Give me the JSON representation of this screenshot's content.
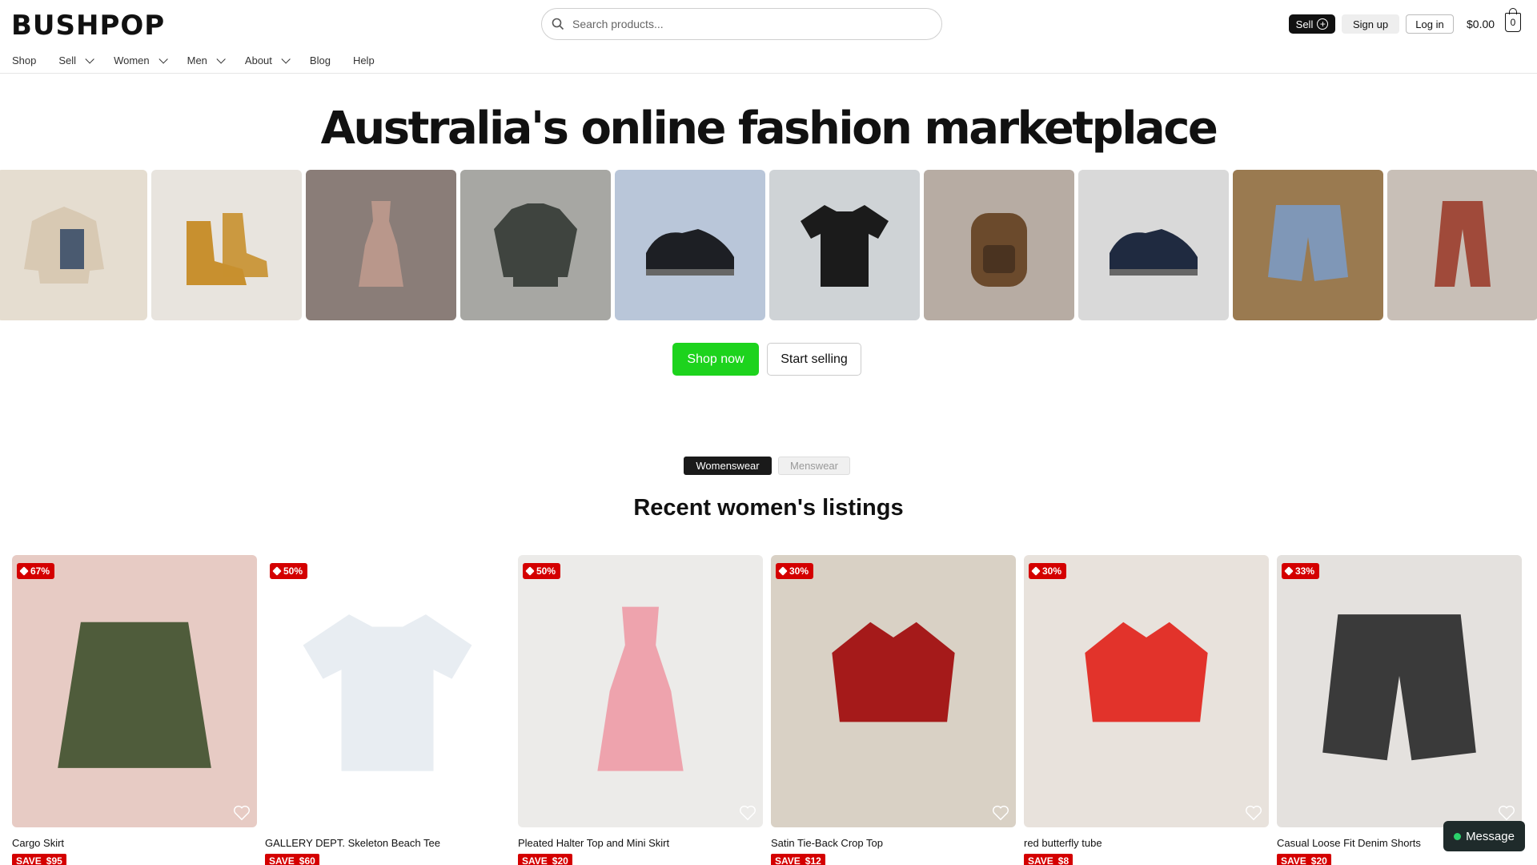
{
  "brand": {
    "logo": "BUSHPOP"
  },
  "search": {
    "placeholder": "Search products..."
  },
  "header": {
    "sell_label": "Sell",
    "signup_label": "Sign up",
    "login_label": "Log in",
    "cart_total": "$0.00",
    "cart_count": "0"
  },
  "nav": {
    "shop": "Shop",
    "sell": "Sell",
    "women": "Women",
    "men": "Men",
    "about": "About",
    "blog": "Blog",
    "help": "Help"
  },
  "hero": {
    "title": "Australia's online fashion marketplace",
    "shop_now": "Shop now",
    "start_selling": "Start selling",
    "tiles": [
      {
        "icon": "fleece-jacket-icon",
        "bg": "#e5ddd0",
        "fg": "#d8c9b3"
      },
      {
        "icon": "boots-icon",
        "bg": "#e8e4de",
        "fg": "#c8902f"
      },
      {
        "icon": "dress-icon",
        "bg": "#8a7d78",
        "fg": "#b9978b"
      },
      {
        "icon": "jacket-icon",
        "bg": "#a7a7a3",
        "fg": "#3f443f"
      },
      {
        "icon": "sneaker-icon",
        "bg": "#b9c6d9",
        "fg": "#1d1f24"
      },
      {
        "icon": "tshirt-icon",
        "bg": "#cfd3d6",
        "fg": "#1b1b1b"
      },
      {
        "icon": "backpack-icon",
        "bg": "#b7aca3",
        "fg": "#6b4a2c"
      },
      {
        "icon": "sneaker-icon",
        "bg": "#d9d9d9",
        "fg": "#1f2a40"
      },
      {
        "icon": "shorts-icon",
        "bg": "#9a7a50",
        "fg": "#7f97b7"
      },
      {
        "icon": "pants-icon",
        "bg": "#c8bfb7",
        "fg": "#a04a3a"
      }
    ]
  },
  "toggle": {
    "womens": "Womenswear",
    "mens": "Menswear"
  },
  "listings": {
    "title": "Recent women's listings",
    "items": [
      {
        "name": "Cargo Skirt",
        "discount": "67%",
        "save": "SAVE",
        "amount": "$95",
        "bg": "#e7cbc4",
        "fg": "#4f5c3b",
        "icon": "skirt-icon"
      },
      {
        "name": "GALLERY DEPT. Skeleton Beach Tee",
        "discount": "50%",
        "save": "SAVE",
        "amount": "$60",
        "bg": "#ffffff",
        "fg": "#e8edf2",
        "icon": "tshirt-icon"
      },
      {
        "name": "Pleated Halter Top and Mini Skirt",
        "discount": "50%",
        "save": "SAVE",
        "amount": "$20",
        "bg": "#ecebe9",
        "fg": "#eea3ad",
        "icon": "dress-icon"
      },
      {
        "name": "Satin Tie-Back Crop Top",
        "discount": "30%",
        "save": "SAVE",
        "amount": "$12",
        "bg": "#d9d1c5",
        "fg": "#a51a1a",
        "icon": "crop-top-icon"
      },
      {
        "name": "red butterfly tube",
        "discount": "30%",
        "save": "SAVE",
        "amount": "$8",
        "bg": "#e8e2dc",
        "fg": "#e2332b",
        "icon": "crop-top-icon"
      },
      {
        "name": "Casual Loose Fit Denim Shorts",
        "discount": "33%",
        "save": "SAVE",
        "amount": "$20",
        "bg": "#e4e1de",
        "fg": "#3a3a3a",
        "icon": "shorts-icon"
      }
    ]
  },
  "message": {
    "label": "Message"
  },
  "colors": {
    "shop_green": "#1dd31d",
    "sale_red": "#d40000"
  }
}
